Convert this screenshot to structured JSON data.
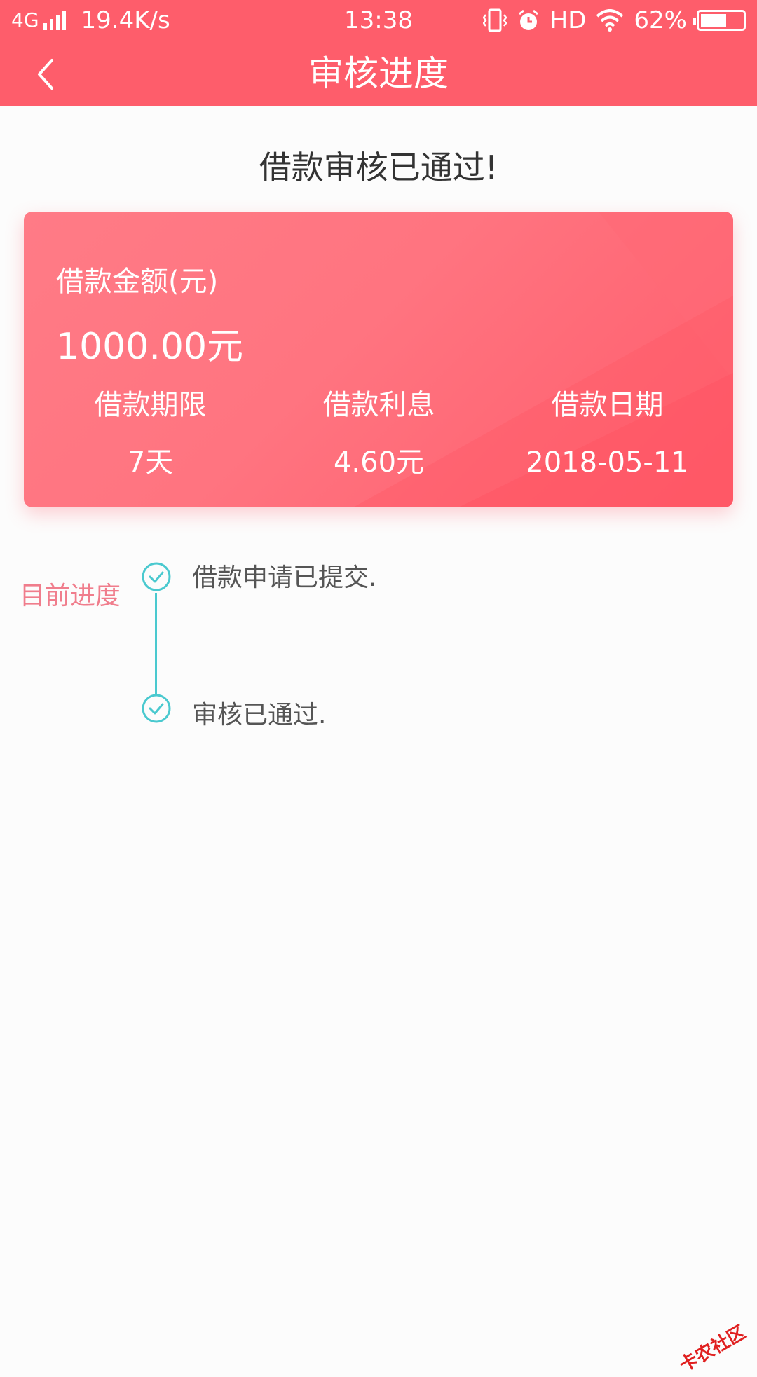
{
  "status_bar": {
    "network": "4G",
    "speed": "19.4K/s",
    "time": "13:38",
    "hd": "HD",
    "battery": "62%",
    "battery_level": 0.62
  },
  "nav": {
    "title": "审核进度"
  },
  "result_title": "借款审核已通过!",
  "card": {
    "amount_label": "借款金额(元)",
    "amount_value": "1000.00元",
    "columns": [
      {
        "label": "借款期限",
        "value": "7天"
      },
      {
        "label": "借款利息",
        "value": "4.60元"
      },
      {
        "label": "借款日期",
        "value": "2018-05-11"
      }
    ]
  },
  "progress": {
    "label": "目前进度",
    "steps": [
      {
        "text": "借款申请已提交.",
        "icon": "check-circle-icon"
      },
      {
        "text": "审核已通过.",
        "icon": "check-circle-icon"
      }
    ]
  },
  "watermark": "卡农社区",
  "colors": {
    "header": "#fe5d6b",
    "card": "#ff7480",
    "accent": "#4ac9cf",
    "progress_label": "#f07d8c"
  }
}
